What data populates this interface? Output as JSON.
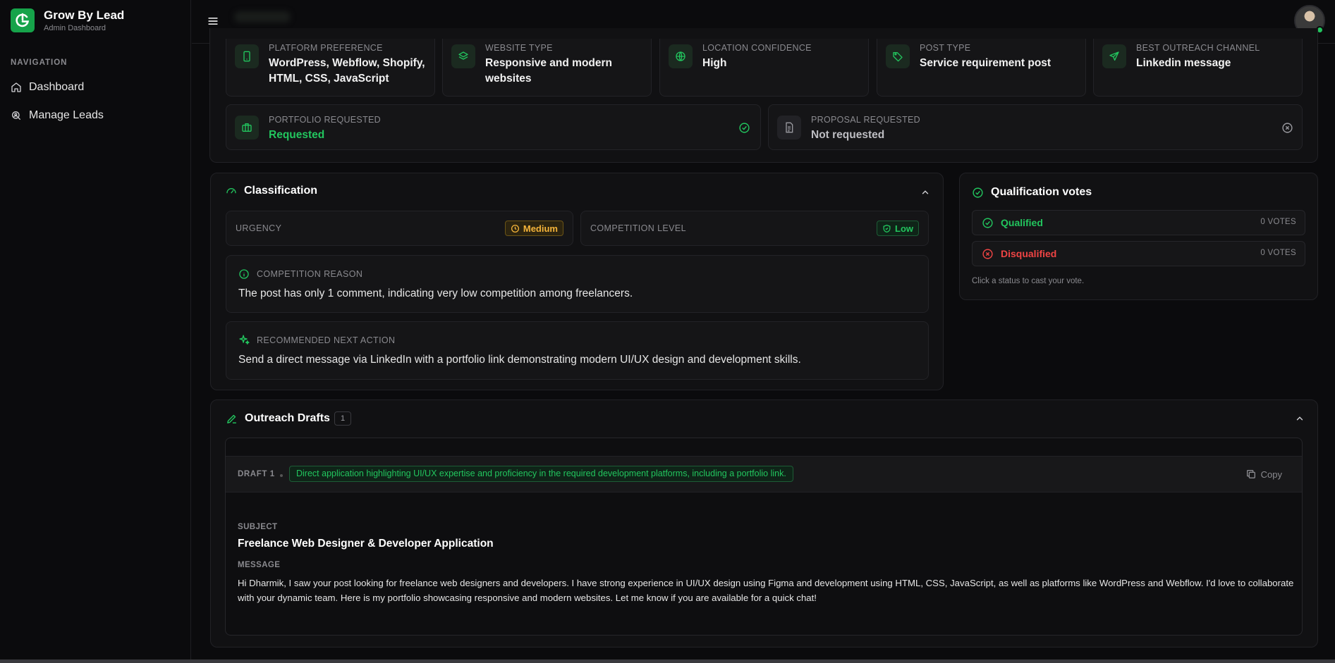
{
  "sidebar": {
    "brand_title": "Grow By Lead",
    "brand_subtitle": "Admin Dashboard",
    "nav_heading": "NAVIGATION",
    "items": [
      {
        "label": "Dashboard",
        "icon": "home-icon"
      },
      {
        "label": "Manage Leads",
        "icon": "search-leads-icon"
      }
    ]
  },
  "info_cards": [
    {
      "label": "PLATFORM PREFERENCE",
      "value": "WordPress, Webflow, Shopify, HTML, CSS, JavaScript",
      "icon": "smartphone-icon"
    },
    {
      "label": "WEBSITE TYPE",
      "value": "Responsive and modern websites",
      "icon": "layers-icon"
    },
    {
      "label": "LOCATION CONFIDENCE",
      "value": "High",
      "icon": "globe-icon"
    },
    {
      "label": "POST TYPE",
      "value": "Service requirement post",
      "icon": "tag-icon"
    },
    {
      "label": "BEST OUTREACH CHANNEL",
      "value": "Linkedin message",
      "icon": "send-icon"
    }
  ],
  "portfolio": {
    "label": "PORTFOLIO REQUESTED",
    "value": "Requested"
  },
  "proposal": {
    "label": "PROPOSAL REQUESTED",
    "value": "Not requested"
  },
  "classification": {
    "title": "Classification",
    "urgency_label": "URGENCY",
    "urgency_value": "Medium",
    "competition_label": "COMPETITION LEVEL",
    "competition_value": "Low",
    "reason_label": "COMPETITION REASON",
    "reason_text": "The post has only 1 comment, indicating very low competition among freelancers.",
    "next_label": "RECOMMENDED NEXT ACTION",
    "next_text": "Send a direct message via LinkedIn with a portfolio link demonstrating modern UI/UX design and development skills."
  },
  "votes": {
    "title": "Qualification votes",
    "options": [
      {
        "label": "Qualified",
        "count": "0 VOTES",
        "color": "#22c55e"
      },
      {
        "label": "Disqualified",
        "count": "0 VOTES",
        "color": "#ef4444"
      }
    ],
    "hint": "Click a status to cast your vote."
  },
  "outreach": {
    "title": "Outreach Drafts",
    "count": "1",
    "draft_label": "DRAFT 1",
    "draft_tag": "Direct application highlighting UI/UX expertise and proficiency in the required development platforms, including a portfolio link.",
    "copy_label": "Copy",
    "subject_label": "SUBJECT",
    "subject": "Freelance Web Designer & Developer Application",
    "message_label": "MESSAGE",
    "message": "Hi Dharmik, I saw your post looking for freelance web designers and developers. I have strong experience in UI/UX design using Figma and development using HTML, CSS, JavaScript, as well as platforms like WordPress and Webflow. I'd love to collaborate with your dynamic team. Here is my portfolio showcasing responsive and modern websites. Let me know if you are available for a quick chat!"
  },
  "colors": {
    "accent": "#22c55e",
    "danger": "#ef4444",
    "warning": "#f5b43a",
    "background": "#0b0b0d"
  }
}
